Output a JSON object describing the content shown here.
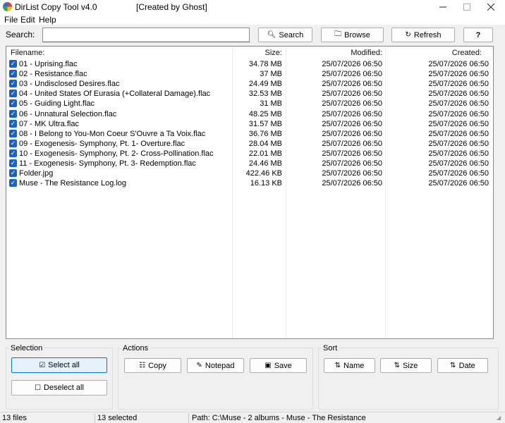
{
  "window": {
    "title": "DirList Copy Tool v4.0",
    "subtitle": "[Created by Ghost]"
  },
  "menu": [
    "File",
    "Edit",
    "Help"
  ],
  "search": {
    "label": "Search:",
    "value": "",
    "search_label": "Search",
    "browse_label": "Browse",
    "refresh_label": "Refresh",
    "help_label": "?"
  },
  "table": {
    "columns": [
      "Filename:",
      "Size:",
      "Modified:",
      "Created:"
    ],
    "rows": [
      {
        "name": "01 - Uprising.flac",
        "size": "34.78 MB",
        "modified": "25/07/2026 06:50",
        "created": "25/07/2026 06:50"
      },
      {
        "name": "02 - Resistance.flac",
        "size": "37 MB",
        "modified": "25/07/2026 06:50",
        "created": "25/07/2026 06:50"
      },
      {
        "name": "03 - Undisclosed Desires.flac",
        "size": "24.49 MB",
        "modified": "25/07/2026 06:50",
        "created": "25/07/2026 06:50"
      },
      {
        "name": "04 - United States Of Eurasia (+Collateral Damage).flac",
        "size": "32.53 MB",
        "modified": "25/07/2026 06:50",
        "created": "25/07/2026 06:50"
      },
      {
        "name": "05 - Guiding Light.flac",
        "size": "31 MB",
        "modified": "25/07/2026 06:50",
        "created": "25/07/2026 06:50"
      },
      {
        "name": "06 - Unnatural Selection.flac",
        "size": "48.25 MB",
        "modified": "25/07/2026 06:50",
        "created": "25/07/2026 06:50"
      },
      {
        "name": "07 - MK Ultra.flac",
        "size": "31.57 MB",
        "modified": "25/07/2026 06:50",
        "created": "25/07/2026 06:50"
      },
      {
        "name": "08 - I Belong to You-Mon Coeur S'Ouvre a Ta Voix.flac",
        "size": "36.76 MB",
        "modified": "25/07/2026 06:50",
        "created": "25/07/2026 06:50"
      },
      {
        "name": "09 - Exogenesis- Symphony, Pt. 1- Overture.flac",
        "size": "28.04 MB",
        "modified": "25/07/2026 06:50",
        "created": "25/07/2026 06:50"
      },
      {
        "name": "10 - Exogenesis- Symphony, Pt. 2- Cross-Pollination.flac",
        "size": "22.01 MB",
        "modified": "25/07/2026 06:50",
        "created": "25/07/2026 06:50"
      },
      {
        "name": "11 - Exogenesis- Symphony, Pt. 3- Redemption.flac",
        "size": "24.46 MB",
        "modified": "25/07/2026 06:50",
        "created": "25/07/2026 06:50"
      },
      {
        "name": "Folder.jpg",
        "size": "422.46 KB",
        "modified": "25/07/2026 06:50",
        "created": "25/07/2026 06:50"
      },
      {
        "name": "Muse - The Resistance Log.log",
        "size": "16.13 KB",
        "modified": "25/07/2026 06:50",
        "created": "25/07/2026 06:50"
      }
    ]
  },
  "selection": {
    "title": "Selection",
    "select_all_label": "Select all",
    "deselect_all_label": "Deselect all"
  },
  "actions": {
    "title": "Actions",
    "copy_label": "Copy",
    "notepad_label": "Notepad",
    "save_label": "Save"
  },
  "sort": {
    "title": "Sort",
    "name_label": "Name",
    "size_label": "Size",
    "date_label": "Date"
  },
  "status": {
    "files": "13 files",
    "selected": "13 selected",
    "path": "Path: C:\\Muse - 2 albums - Muse - The Resistance"
  },
  "colors": {
    "checkbox": "#1a63c6",
    "accent_border": "#0078d7"
  }
}
